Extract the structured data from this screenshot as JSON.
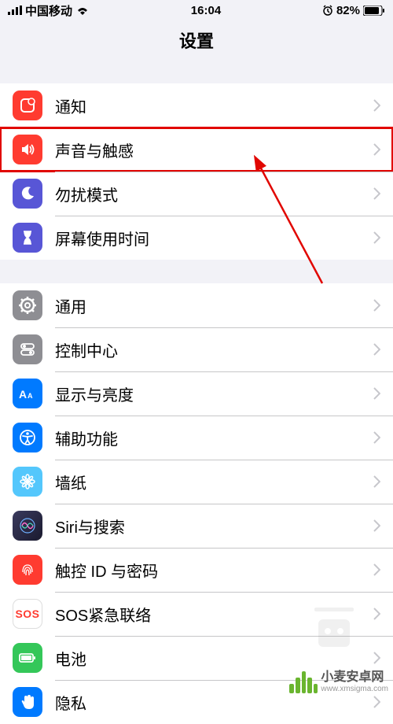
{
  "status": {
    "carrier": "中国移动",
    "time": "16:04",
    "battery": "82%"
  },
  "nav": {
    "title": "设置"
  },
  "group1": [
    {
      "key": "notifications",
      "label": "通知"
    },
    {
      "key": "sounds",
      "label": "声音与触感",
      "highlighted": true
    },
    {
      "key": "dnd",
      "label": "勿扰模式"
    },
    {
      "key": "screentime",
      "label": "屏幕使用时间"
    }
  ],
  "group2": [
    {
      "key": "general",
      "label": "通用"
    },
    {
      "key": "control",
      "label": "控制中心"
    },
    {
      "key": "display",
      "label": "显示与亮度"
    },
    {
      "key": "accessibility",
      "label": "辅助功能"
    },
    {
      "key": "wallpaper",
      "label": "墙纸"
    },
    {
      "key": "siri",
      "label": "Siri与搜索"
    },
    {
      "key": "touchid",
      "label": "触控 ID 与密码"
    },
    {
      "key": "sos",
      "label": "SOS紧急联络"
    },
    {
      "key": "battery",
      "label": "电池"
    },
    {
      "key": "privacy",
      "label": "隐私"
    }
  ],
  "watermark": {
    "text": "小麦安卓网",
    "url": "www.xmsigma.com"
  }
}
